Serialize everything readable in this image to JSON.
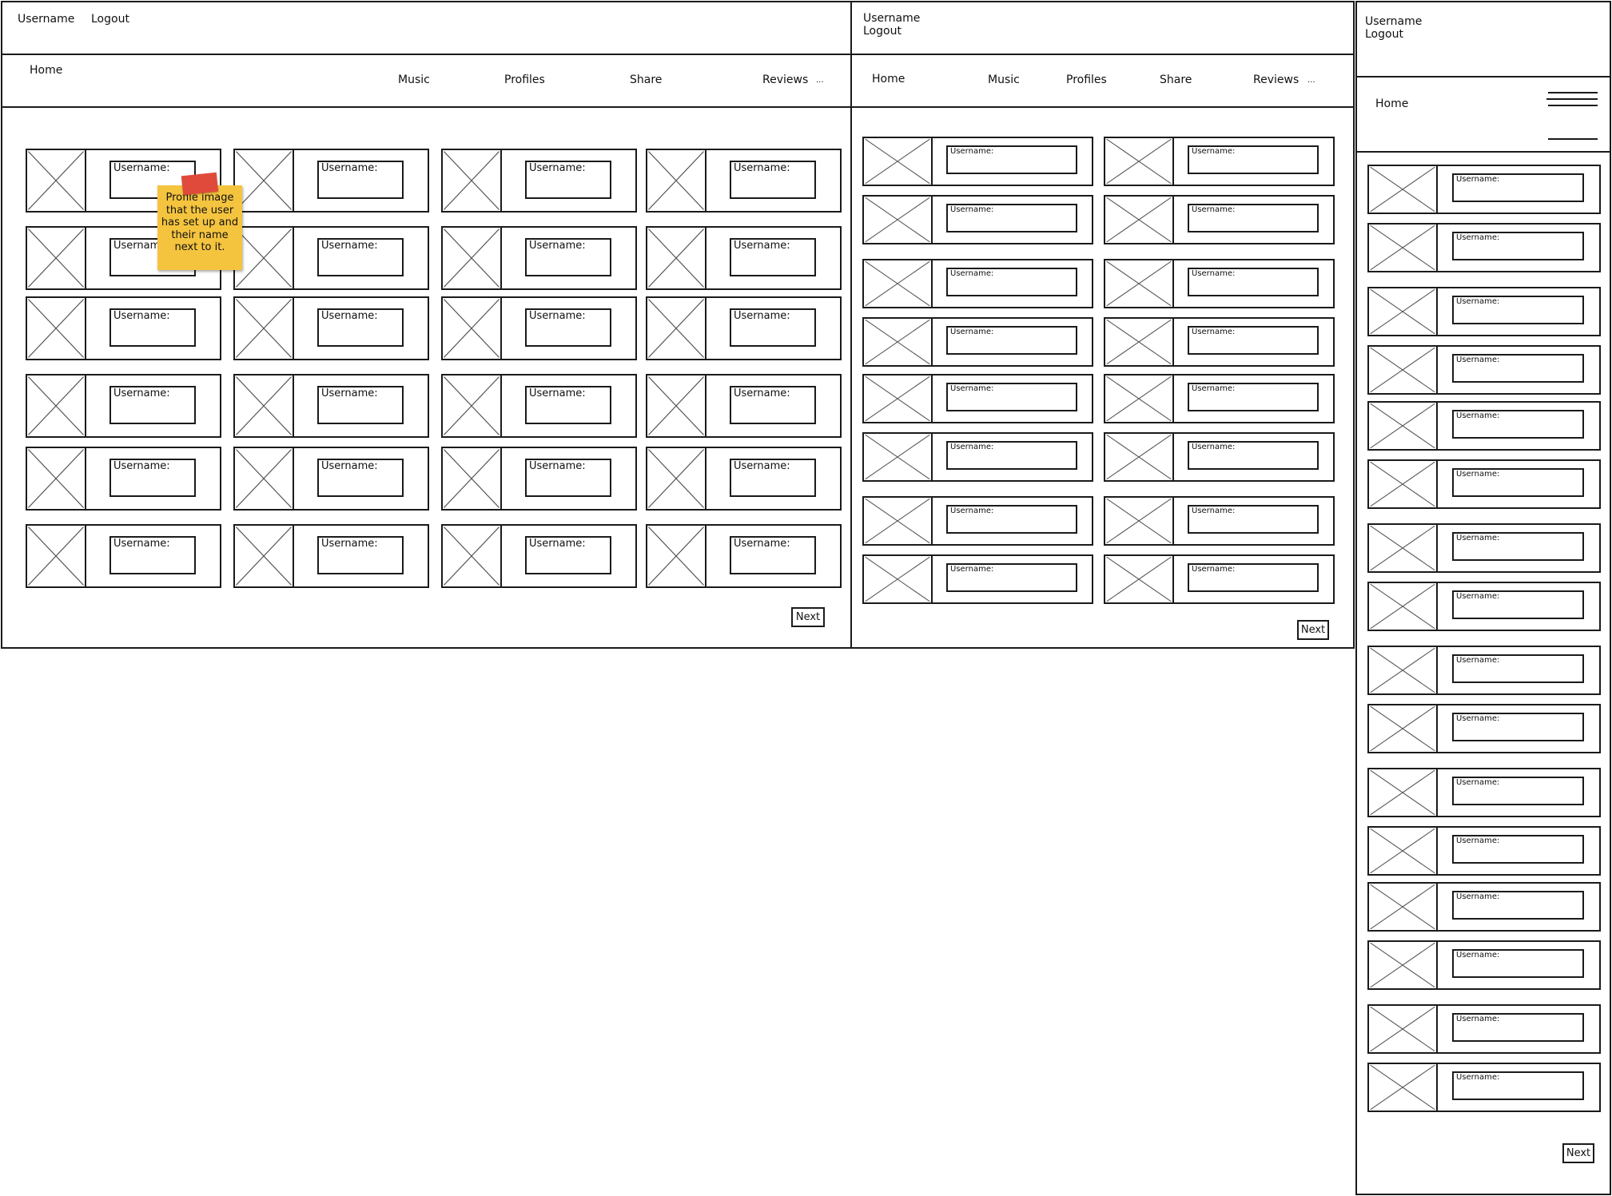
{
  "desktop": {
    "username": "Username",
    "logout": "Logout",
    "nav": [
      "Home",
      "Music",
      "Profiles",
      "Share",
      "Reviews",
      "..."
    ],
    "card_label": "Username:",
    "next": "Next"
  },
  "tablet": {
    "username": "Username",
    "logout": "Logout",
    "nav": [
      "Home",
      "Music",
      "Profiles",
      "Share",
      "Reviews",
      "..."
    ],
    "card_label": "Username:",
    "next": "Next"
  },
  "mobile": {
    "username": "Username",
    "logout": "Logout",
    "home": "Home",
    "menu_icon": "hamburger-menu-icon",
    "card_label": "Username:",
    "next": "Next"
  },
  "annotation": {
    "note": "Profile image that the user has set up and their name next to it."
  }
}
